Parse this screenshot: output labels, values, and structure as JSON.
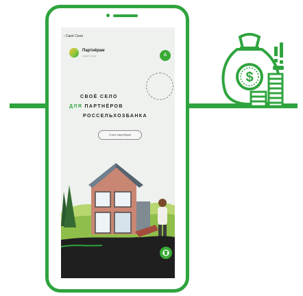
{
  "screen": {
    "back_label": "‹ Своё Село",
    "header": {
      "title": "Партнёрам",
      "subtitle": "Своё Село",
      "badge": "А"
    },
    "hero": {
      "line1": "СВОЁ СЕЛО",
      "line2_accent": "ДЛЯ",
      "line2_rest": " ПАРТНЁРОВ",
      "line3": "РОССЕЛЬХОЗБАНКА"
    },
    "button_label": "Стать партнёром"
  },
  "colors": {
    "accent": "#2fa43e",
    "badge": "#3aaa35"
  },
  "icons": [
    "money-bag-icon",
    "dollar-sign-icon",
    "coin-stack-icon",
    "exclamation-icon",
    "chat-icon"
  ]
}
